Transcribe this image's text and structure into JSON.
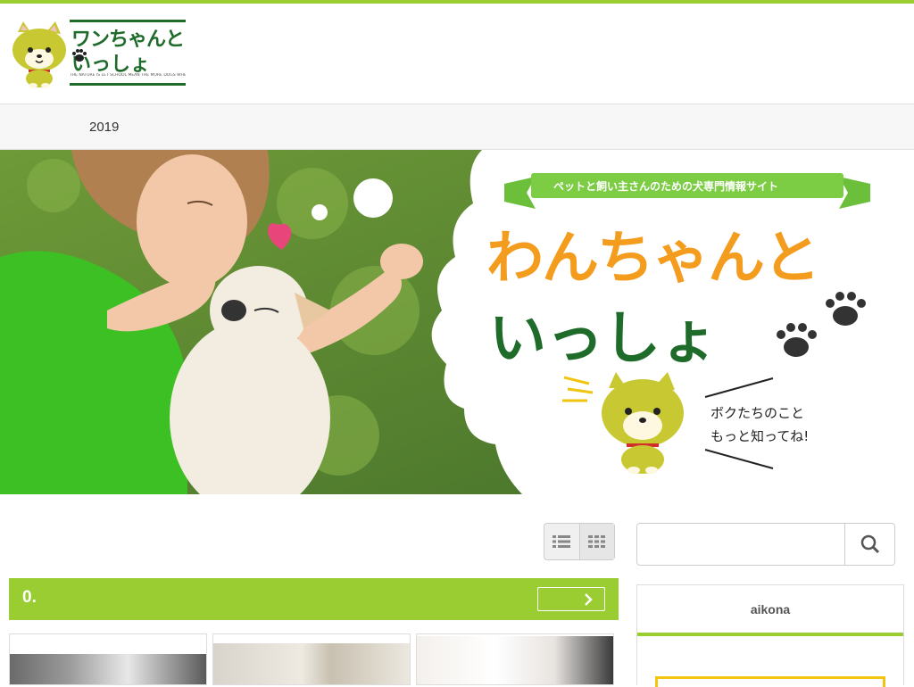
{
  "site": {
    "logo_line1": "ワンちゃんと",
    "logo_line2": "いっしょ",
    "logo_tagline": "THE NATURE IS LET SCHOOL MEAN THE MORE DOGS WHERE LIVING DAILY"
  },
  "nav": {
    "items": [
      "2019"
    ]
  },
  "hero": {
    "ribbon": "ペットと飼い主さんのための犬専門情報サイト",
    "title_line1": "わんちゃんと",
    "title_line2": "いっしょ",
    "speech_line1": "ボクたちのこと",
    "speech_line2": "もっと知ってね!"
  },
  "main": {
    "view_list_icon": "list-view-icon",
    "view_grid_icon": "grid-view-icon",
    "section_title": "0.",
    "more_icon": "chevron-right-icon"
  },
  "sidebar": {
    "search_placeholder": "",
    "search_icon": "search-icon",
    "widget_title": "aikona"
  },
  "colors": {
    "accent": "#9acd32",
    "dark_green": "#1e6b2a",
    "orange": "#f39c1e",
    "yellow_border": "#f1c40f"
  }
}
